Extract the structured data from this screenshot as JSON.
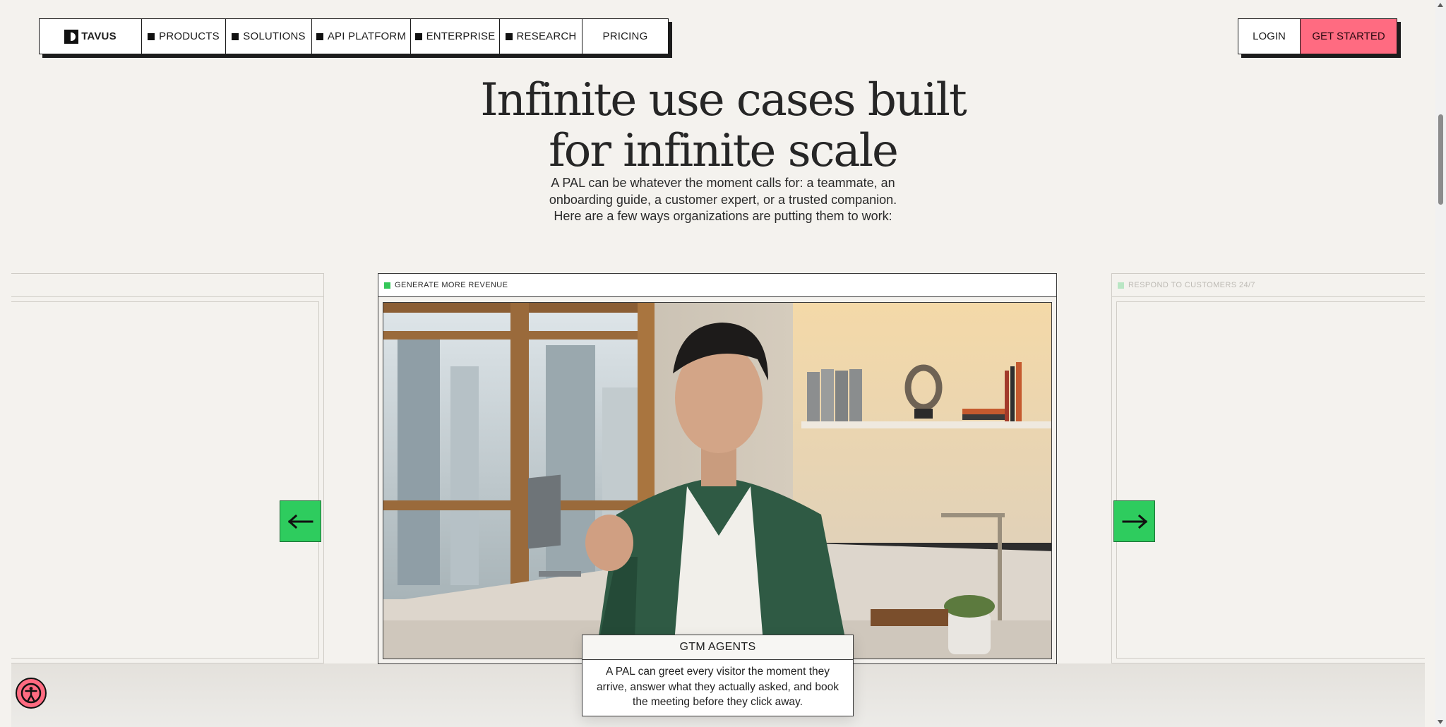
{
  "nav": {
    "logo": "TAVUS",
    "items": [
      {
        "label": "PRODUCTS",
        "has_square": true
      },
      {
        "label": "SOLUTIONS",
        "has_square": true
      },
      {
        "label": "API PLATFORM",
        "has_square": true
      },
      {
        "label": "ENTERPRISE",
        "has_square": true
      },
      {
        "label": "RESEARCH",
        "has_square": true
      },
      {
        "label": "PRICING",
        "has_square": false
      }
    ],
    "login": "LOGIN",
    "get_started": "GET STARTED"
  },
  "hero": {
    "title_line1": "Infinite use cases built",
    "title_line2": "for infinite scale",
    "subtitle": "A PAL can be whatever the moment calls for: a teammate, an onboarding guide, a customer expert, or a trusted companion. Here are a few ways organizations are putting them to work:"
  },
  "carousel": {
    "center": {
      "tag": "GENERATE MORE REVENUE",
      "caption_title": "GTM AGENTS",
      "caption_body": "A PAL can greet every visitor the moment they arrive, answer what they actually asked, and book the meeting before they click away."
    },
    "right": {
      "tag": "RESPOND TO CUSTOMERS 24/7"
    },
    "prev_icon": "arrow-left-icon",
    "next_icon": "arrow-right-icon"
  },
  "colors": {
    "background": "#f4f2ee",
    "accent_pink": "#ff6b81",
    "accent_green": "#2ecc5e"
  },
  "accessibility": {
    "icon": "accessibility-icon"
  }
}
